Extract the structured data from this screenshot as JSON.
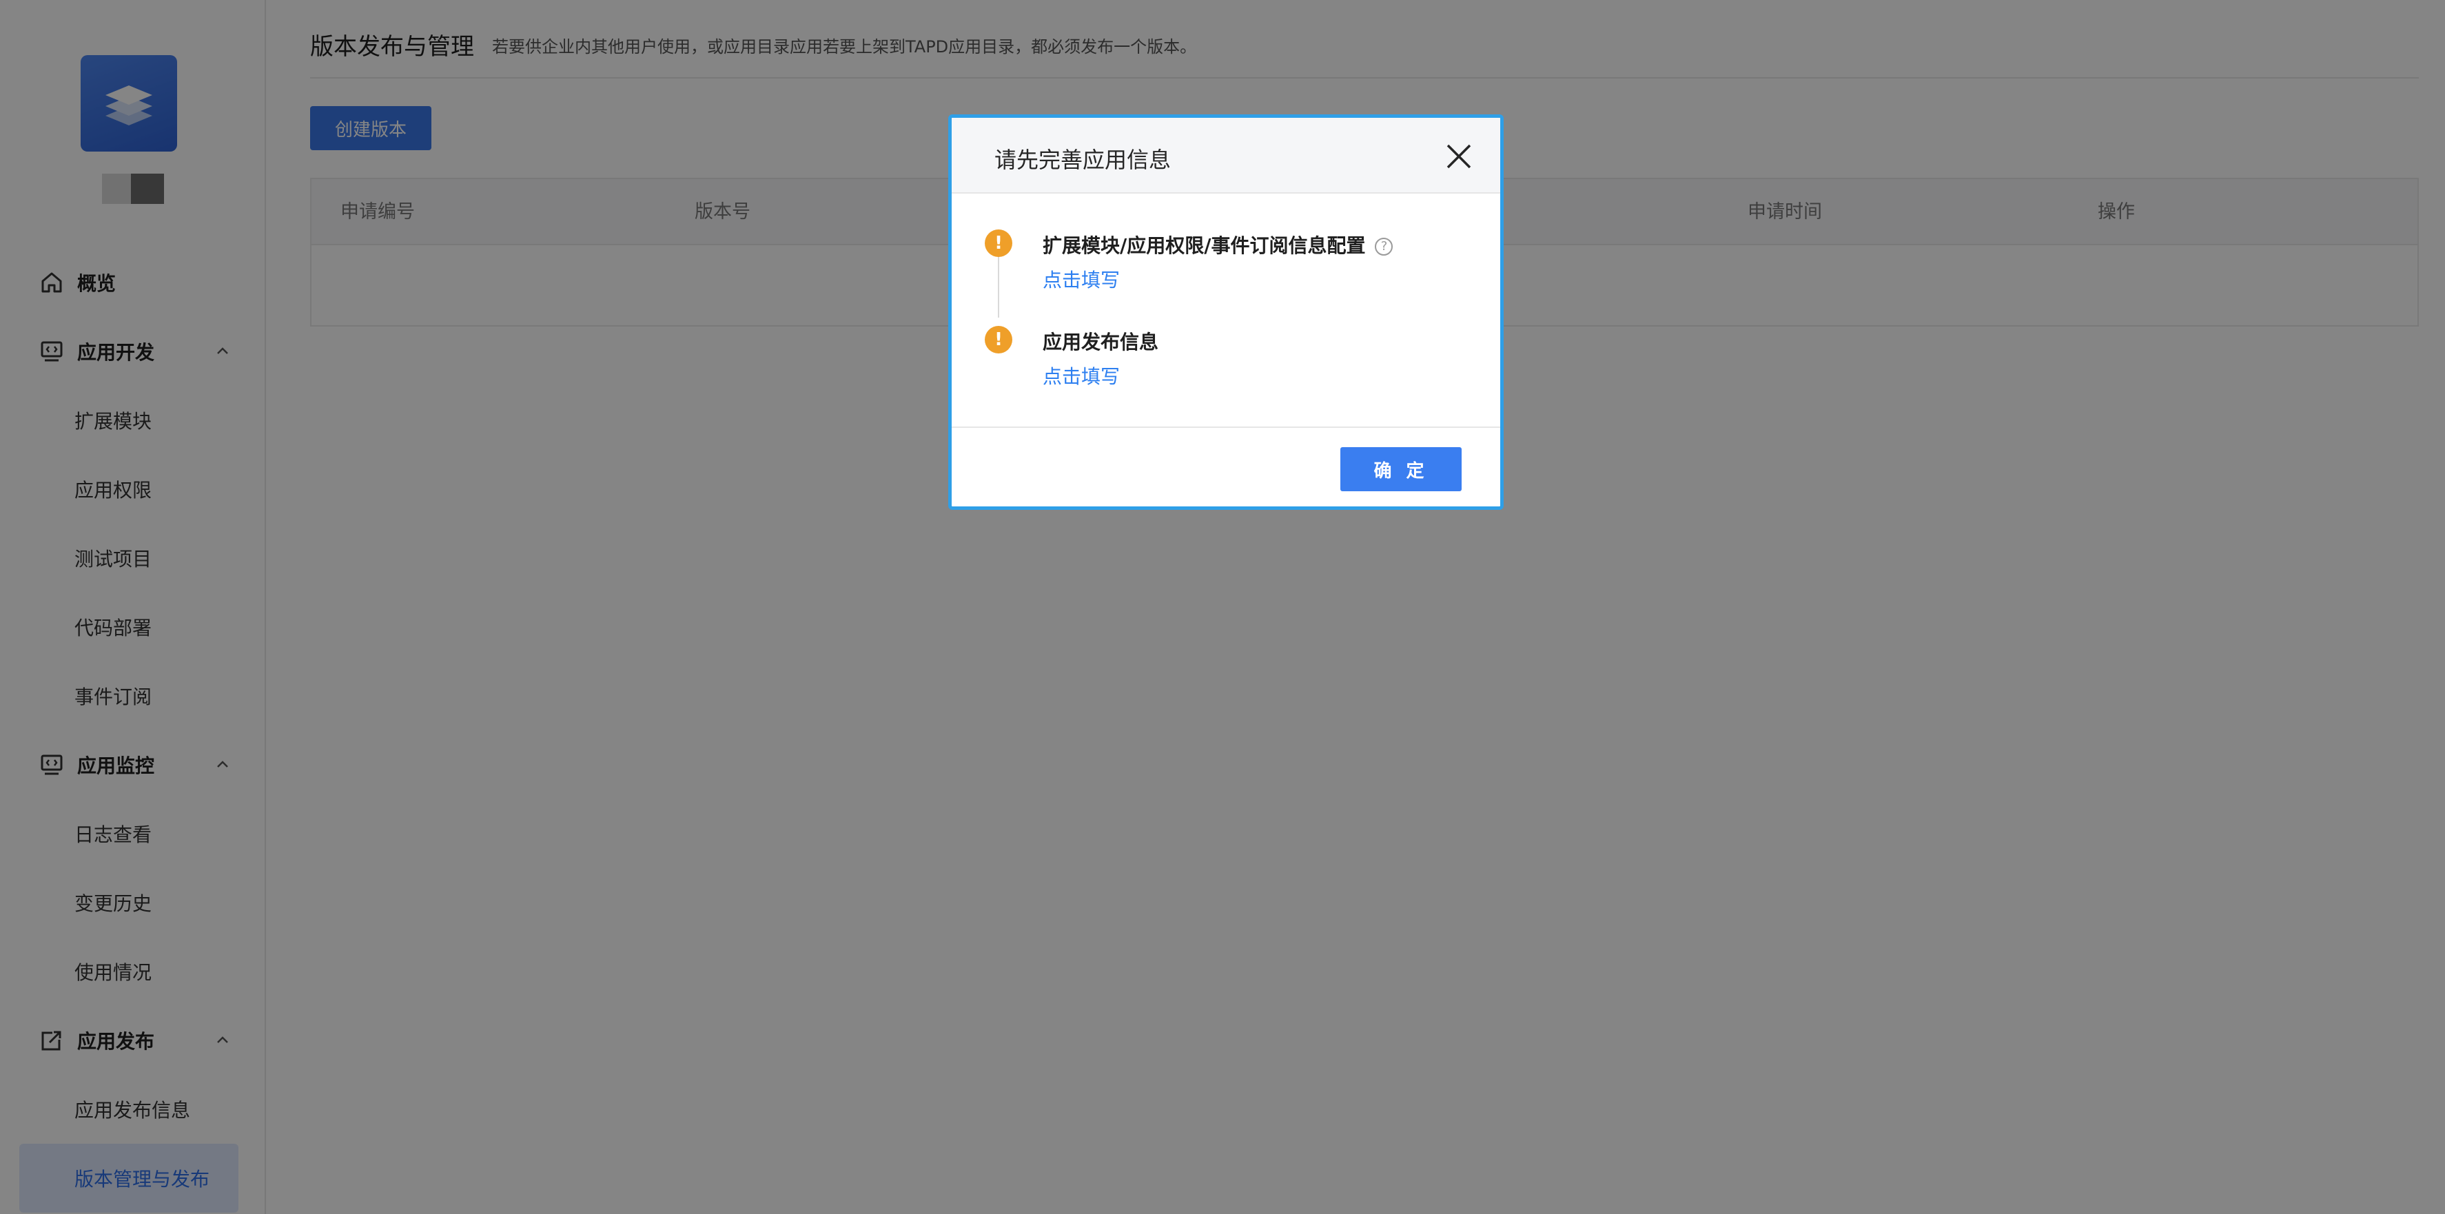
{
  "sidebar": {
    "nav": {
      "overview": "概览",
      "group_dev": {
        "label": "应用开发",
        "items": [
          "扩展模块",
          "应用权限",
          "测试项目",
          "代码部署",
          "事件订阅"
        ]
      },
      "group_monitor": {
        "label": "应用监控",
        "items": [
          "日志查看",
          "变更历史",
          "使用情况"
        ]
      },
      "group_publish": {
        "label": "应用发布",
        "items": [
          "应用发布信息",
          "版本管理与发布"
        ]
      }
    }
  },
  "main": {
    "title": "版本发布与管理",
    "subtitle": "若要供企业内其他用户使用，或应用目录应用若要上架到TAPD应用目录，都必须发布一个版本。",
    "create_button": "创建版本",
    "table": {
      "headers": [
        "申请编号",
        "版本号",
        "申请时间",
        "操作"
      ]
    }
  },
  "dialog": {
    "title": "请先完善应用信息",
    "steps": [
      {
        "title": "扩展模块/应用权限/事件订阅信息配置",
        "link": "点击填写"
      },
      {
        "title": "应用发布信息",
        "link": "点击填写"
      }
    ],
    "ok_button": "确 定"
  },
  "colors": {
    "primary": "#3a7ef0",
    "warning": "#ef9f29",
    "active_bg": "#dfe9fd",
    "dialog_border": "#2f9fe7",
    "link": "#2d7ff0"
  },
  "icons": {
    "overview": "home-icon",
    "dev": "code-monitor-icon",
    "monitor": "code-monitor-icon",
    "publish": "publish-icon",
    "close": "close-icon",
    "warning": "warning-icon",
    "help": "help-icon",
    "collapse": "chevron-up-icon"
  }
}
